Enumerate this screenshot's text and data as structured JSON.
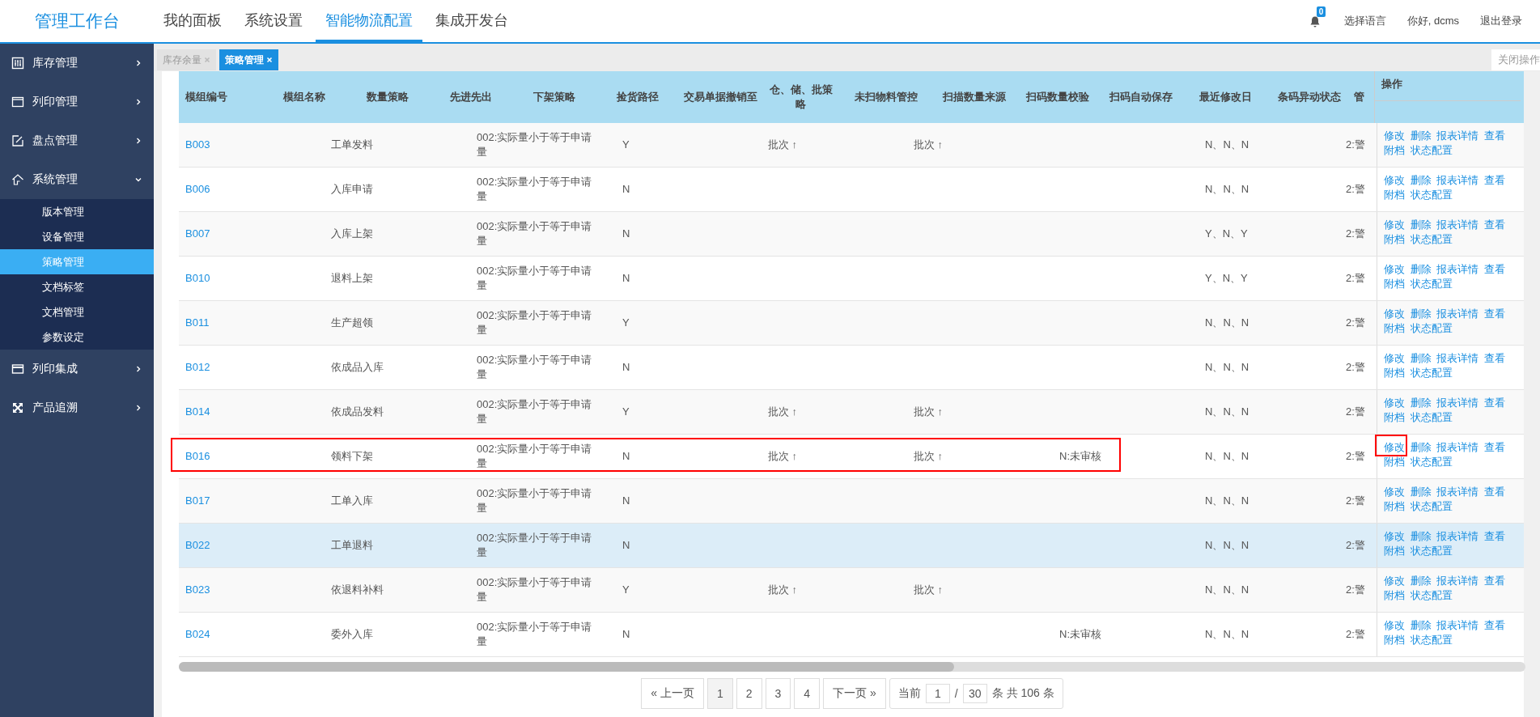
{
  "logo": "管理工作台",
  "nav": [
    {
      "label": "我的面板",
      "selected": false
    },
    {
      "label": "系统设置",
      "selected": false
    },
    {
      "label": "智能物流配置",
      "selected": true
    },
    {
      "label": "集成开发台",
      "selected": false
    }
  ],
  "notifications": {
    "count": "0"
  },
  "user_menu": [
    "选择语言",
    "你好, dcms",
    "退出登录"
  ],
  "sidebar": {
    "items": [
      {
        "label": "库存管理",
        "expanded": false
      },
      {
        "label": "列印管理",
        "expanded": false
      },
      {
        "label": "盘点管理",
        "expanded": false
      },
      {
        "label": "系统管理",
        "expanded": true,
        "children": [
          {
            "label": "版本管理",
            "selected": false
          },
          {
            "label": "设备管理",
            "selected": false
          },
          {
            "label": "策略管理",
            "selected": true
          },
          {
            "label": "文档标签",
            "selected": false
          },
          {
            "label": "文档管理",
            "selected": false
          },
          {
            "label": "参数设定",
            "selected": false
          }
        ]
      },
      {
        "label": "列印集成",
        "expanded": false
      },
      {
        "label": "产品追溯",
        "expanded": false
      }
    ]
  },
  "tabs": [
    {
      "label": "库存余量",
      "selected": false
    },
    {
      "label": "策略管理",
      "selected": true
    }
  ],
  "close_actions": "关闭操作",
  "table": {
    "columns": [
      "模组编号",
      "模组名称",
      "数量策略",
      "先进先出",
      "下架策略",
      "捡货路径",
      "交易单据撤销至",
      "仓、储、批策略",
      "未扫物料管控",
      "扫描数量来源",
      "扫码数量校验",
      "扫码自动保存",
      "最近修改日",
      "条码异动状态",
      "管"
    ],
    "actions_column": "操作",
    "rows": [
      {
        "code": "B003",
        "name": "工单发料",
        "strategy": "002:实际量小于等于申请量",
        "flag": "Y",
        "column_5": "批次 ↑",
        "column_6": "批次 ↑",
        "column_8": "N、N、N",
        "column_9": "2:警",
        "actions": [
          "修改",
          "删除",
          "报表详情",
          "查看",
          "附档",
          "状态配置"
        ],
        "highlighted": false,
        "hovered": false,
        "edit_highlighted": false
      },
      {
        "code": "B006",
        "name": "入库申请",
        "strategy": "002:实际量小于等于申请量",
        "flag": "N",
        "column_8": "N、N、N",
        "column_9": "2:警",
        "actions": [
          "修改",
          "删除",
          "报表详情",
          "查看",
          "附档",
          "状态配置"
        ],
        "highlighted": false,
        "hovered": false,
        "edit_highlighted": false
      },
      {
        "code": "B007",
        "name": "入库上架",
        "strategy": "002:实际量小于等于申请量",
        "flag": "N",
        "column_8": "Y、N、Y",
        "column_9": "2:警",
        "actions": [
          "修改",
          "删除",
          "报表详情",
          "查看",
          "附档",
          "状态配置"
        ],
        "highlighted": false,
        "hovered": false,
        "edit_highlighted": false
      },
      {
        "code": "B010",
        "name": "退料上架",
        "strategy": "002:实际量小于等于申请量",
        "flag": "N",
        "column_8": "Y、N、Y",
        "column_9": "2:警",
        "actions": [
          "修改",
          "删除",
          "报表详情",
          "查看",
          "附档",
          "状态配置"
        ],
        "highlighted": false,
        "hovered": false,
        "edit_highlighted": false
      },
      {
        "code": "B011",
        "name": "生产超领",
        "strategy": "002:实际量小于等于申请量",
        "flag": "Y",
        "column_8": "N、N、N",
        "column_9": "2:警",
        "actions": [
          "修改",
          "删除",
          "报表详情",
          "查看",
          "附档",
          "状态配置"
        ],
        "highlighted": false,
        "hovered": false,
        "edit_highlighted": false
      },
      {
        "code": "B012",
        "name": "依成品入库",
        "strategy": "002:实际量小于等于申请量",
        "flag": "N",
        "column_8": "N、N、N",
        "column_9": "2:警",
        "actions": [
          "修改",
          "删除",
          "报表详情",
          "查看",
          "附档",
          "状态配置"
        ],
        "highlighted": false,
        "hovered": false,
        "edit_highlighted": false
      },
      {
        "code": "B014",
        "name": "依成品发料",
        "strategy": "002:实际量小于等于申请量",
        "flag": "Y",
        "column_5": "批次 ↑",
        "column_6": "批次 ↑",
        "column_8": "N、N、N",
        "column_9": "2:警",
        "actions": [
          "修改",
          "删除",
          "报表详情",
          "查看",
          "附档",
          "状态配置"
        ],
        "highlighted": false,
        "hovered": false,
        "edit_highlighted": false
      },
      {
        "code": "B016",
        "name": "领料下架",
        "strategy": "002:实际量小于等于申请量",
        "flag": "N",
        "column_5": "批次 ↑",
        "column_6": "批次 ↑",
        "column_7": "N:未审核",
        "column_8": "N、N、N",
        "column_9": "2:警",
        "actions": [
          "修改",
          "删除",
          "报表详情",
          "查看",
          "附档",
          "状态配置"
        ],
        "highlighted": true,
        "hovered": false,
        "edit_highlighted": true
      },
      {
        "code": "B017",
        "name": "工单入库",
        "strategy": "002:实际量小于等于申请量",
        "flag": "N",
        "column_8": "N、N、N",
        "column_9": "2:警",
        "actions": [
          "修改",
          "删除",
          "报表详情",
          "查看",
          "附档",
          "状态配置"
        ],
        "highlighted": false,
        "hovered": false,
        "edit_highlighted": false
      },
      {
        "code": "B022",
        "name": "工单退料",
        "strategy": "002:实际量小于等于申请量",
        "flag": "N",
        "column_8": "N、N、N",
        "column_9": "2:警",
        "actions": [
          "修改",
          "删除",
          "报表详情",
          "查看",
          "附档",
          "状态配置"
        ],
        "highlighted": false,
        "hovered": true,
        "edit_highlighted": false
      },
      {
        "code": "B023",
        "name": "依退料补料",
        "strategy": "002:实际量小于等于申请量",
        "flag": "Y",
        "column_5": "批次 ↑",
        "column_6": "批次 ↑",
        "column_8": "N、N、N",
        "column_9": "2:警",
        "actions": [
          "修改",
          "删除",
          "报表详情",
          "查看",
          "附档",
          "状态配置"
        ],
        "highlighted": false,
        "hovered": false,
        "edit_highlighted": false
      },
      {
        "code": "B024",
        "name": "委外入库",
        "strategy": "002:实际量小于等于申请量",
        "flag": "N",
        "column_7": "N:未审核",
        "column_8": "N、N、N",
        "column_9": "2:警",
        "actions": [
          "修改",
          "删除",
          "报表详情",
          "查看",
          "附档",
          "状态配置"
        ],
        "highlighted": false,
        "hovered": false,
        "edit_highlighted": false
      }
    ]
  },
  "pagination": {
    "prev": "« 上一页",
    "pages": [
      {
        "label": "1",
        "selected": true
      },
      {
        "label": "2",
        "selected": false
      },
      {
        "label": "3",
        "selected": false
      },
      {
        "label": "4",
        "selected": false
      }
    ],
    "next": "下一页 »",
    "current_label": "当前",
    "current_page": "1",
    "separator": "/",
    "total_pages": "30",
    "total_text": "条 共 106 条"
  }
}
